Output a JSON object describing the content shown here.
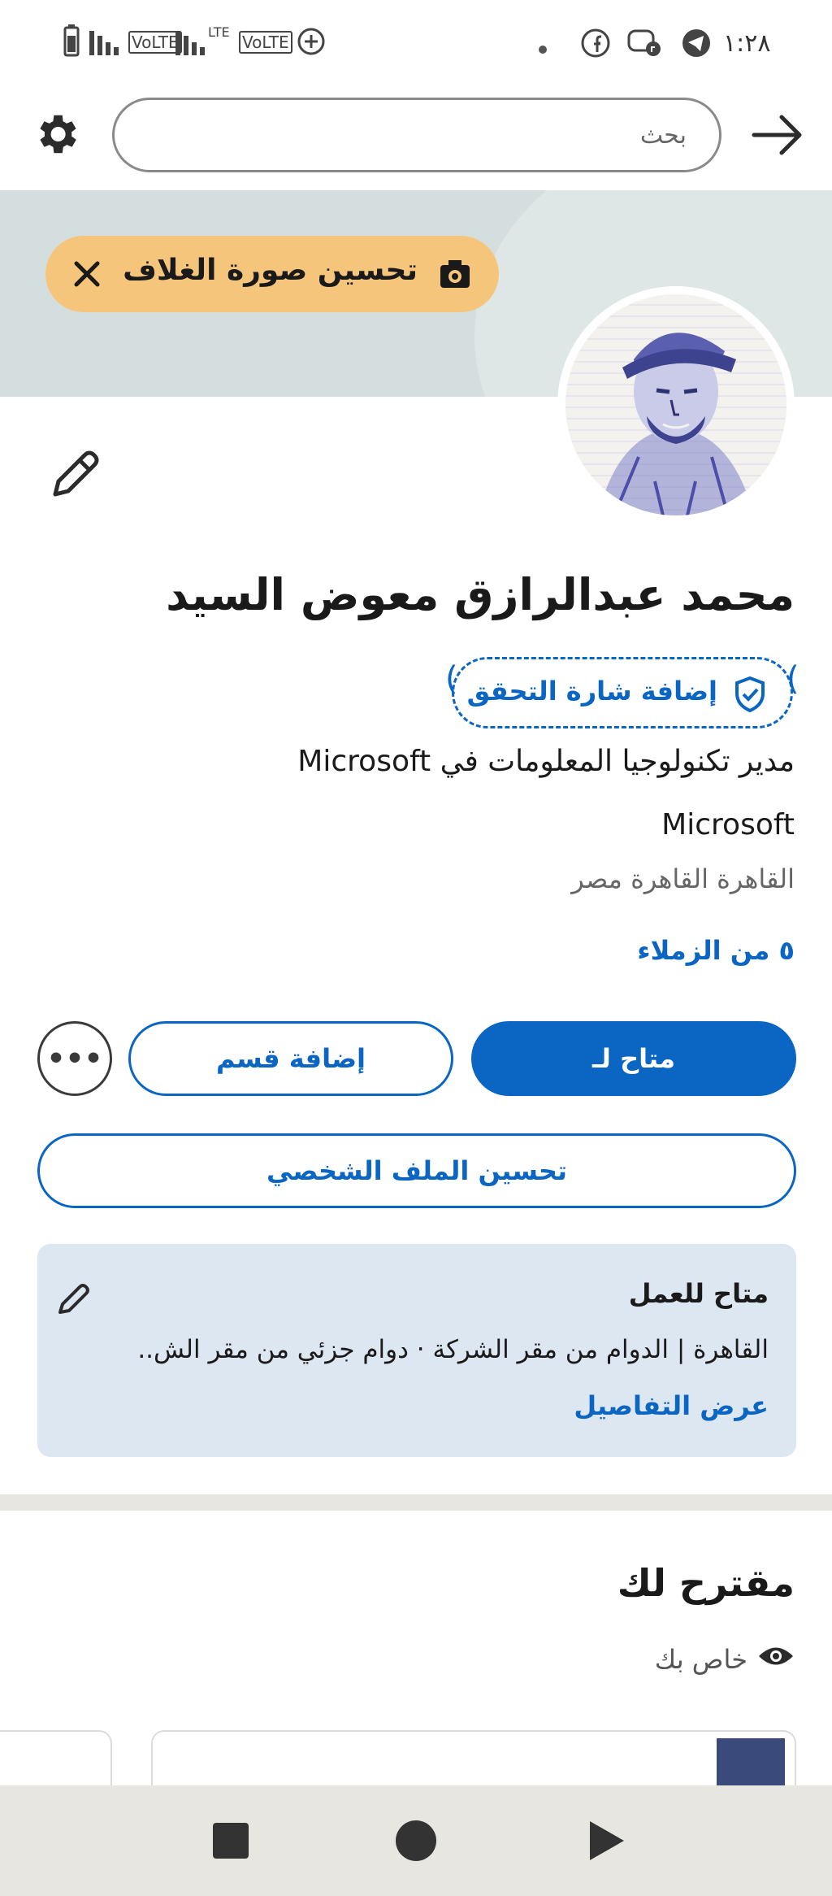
{
  "status_bar": {
    "time": "١:٢٨",
    "network_labels": [
      "VoLTE",
      "LTE",
      "VoLTE"
    ]
  },
  "header": {
    "search_placeholder": "بحث"
  },
  "cover": {
    "improve_cover_label": "تحسين صورة الغلاف"
  },
  "profile": {
    "name": "محمد عبدالرازق معوض السيد",
    "verify_label": "إضافة شارة التحقق",
    "headline": "مدير تكنولوجيا المعلومات  في Microsoft",
    "company": "Microsoft",
    "location": "القاهرة القاهرة مصر",
    "connections": "٥ من الزملاء"
  },
  "actions": {
    "open_to_label": "متاح لـ",
    "add_section_label": "إضافة قسم",
    "more_label": "•••",
    "enhance_profile_label": "تحسين الملف الشخصي"
  },
  "open_to_work": {
    "title": "متاح للعمل",
    "description": "القاهرة | الدوام من مقر الشركة · دوام جزئي من مقر الش..",
    "details_link": "عرض التفاصيل"
  },
  "suggested": {
    "title": "مقترح لك",
    "private_label": "خاص بك"
  },
  "colors": {
    "accent": "#0a66c2",
    "cover_pill": "#f6c57c",
    "card_bg": "#dde7f1"
  }
}
